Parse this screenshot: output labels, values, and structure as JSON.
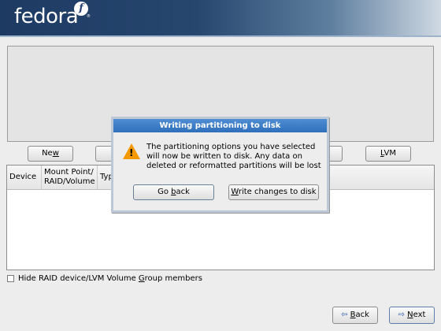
{
  "banner": {
    "brand": "fedora",
    "symbol": "f",
    "trademark": "®"
  },
  "toolbar": {
    "new_label_pre": "Ne",
    "new_label_ul": "w",
    "lvm_label_ul": "L",
    "lvm_label_post": "VM"
  },
  "table": {
    "columns": [
      "Device",
      "Mount Point/ RAID/Volume",
      "Type"
    ]
  },
  "hide_raid": {
    "label_pre": "Hide RAID device/LVM Volume ",
    "label_ul": "G",
    "label_post": "roup members",
    "checked": false
  },
  "dialog": {
    "title": "Writing partitioning to disk",
    "message": "The partitioning options you have selected will now be written to disk.  Any data on deleted or reformatted partitions will be lost",
    "go_back_pre": "Go ",
    "go_back_ul": "b",
    "go_back_post": "ack",
    "write_ul": "W",
    "write_post": "rite changes to disk"
  },
  "nav": {
    "back_ul": "B",
    "back_post": "ack",
    "next_ul": "N",
    "next_post": "ext"
  },
  "colors": {
    "banner": "#27476f",
    "dialog_title": "#3b7dc8",
    "warning": "#f29a00"
  }
}
